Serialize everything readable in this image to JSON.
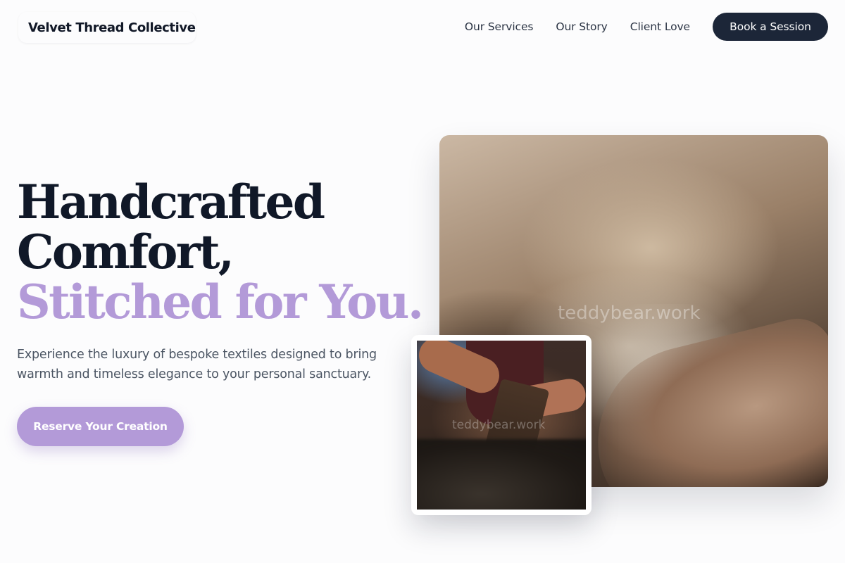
{
  "header": {
    "brand": "Velvet Thread Collective",
    "nav": [
      {
        "label": "Our Services"
      },
      {
        "label": "Our Story"
      },
      {
        "label": "Client Love"
      }
    ],
    "cta_label": "Book a Session"
  },
  "hero": {
    "headline_lines": [
      "Handcrafted",
      "Comfort,",
      "Stitched for You."
    ],
    "subtext": "Experience the luxury of bespoke textiles designed to bring warmth and timeless elegance to your personal sanctuary.",
    "cta_label": "Reserve Your Creation"
  },
  "images": {
    "main_watermark": "teddybear.work",
    "small_watermark": "teddybear.work"
  },
  "colors": {
    "accent": "#b39ad8",
    "dark_button": "#1c2638",
    "headline": "#101828"
  }
}
